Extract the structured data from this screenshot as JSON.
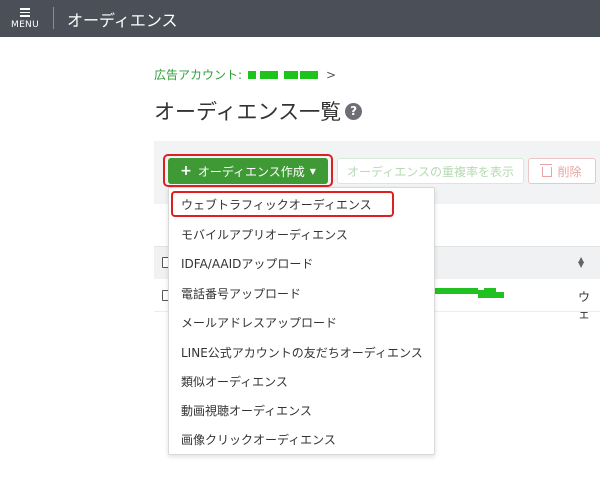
{
  "header": {
    "menu_label": "MENU",
    "title": "オーディエンス"
  },
  "breadcrumb": {
    "label": "広告アカウント:",
    "arrow": ">"
  },
  "page": {
    "title": "オーディエンス一覧",
    "help_icon": "?"
  },
  "toolbar": {
    "create_label": "オーディエンス作成",
    "plus_icon": "+",
    "overlap_label": "オーディエンスの重複率を表示",
    "delete_label": "削除"
  },
  "dropdown": {
    "items": [
      "ウェブトラフィックオーディエンス",
      "モバイルアプリオーディエンス",
      "IDFA/AAIDアップロード",
      "電話番号アップロード",
      "メールアドレスアップロード",
      "LINE公式アカウントの友だちオーディエンス",
      "類似オーディエンス",
      "動画視聴オーディエンス",
      "画像クリックオーディエンス"
    ]
  },
  "table": {
    "row_type": "ウェ"
  },
  "colors": {
    "topbar": "#4b4f58",
    "accent_green": "#3f9a35",
    "highlight_red": "#e02020"
  }
}
